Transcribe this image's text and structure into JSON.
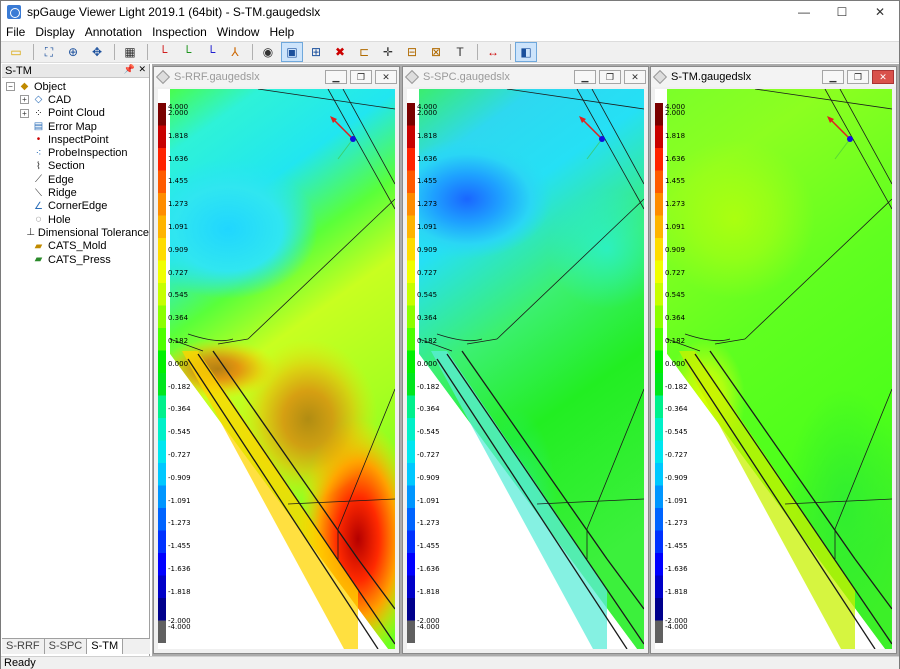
{
  "window": {
    "title": "spGauge Viewer Light 2019.1 (64bit) - S-TM.gaugedslx"
  },
  "menu": [
    "File",
    "Display",
    "Annotation",
    "Inspection",
    "Window",
    "Help"
  ],
  "toolbar_icons": [
    "open-icon",
    "fit-view-icon",
    "zoom-icon",
    "pan-icon",
    "grid-icon",
    "axis-x-icon",
    "axis-y-icon",
    "axis-z-icon",
    "axis-iso-icon",
    "eye-icon",
    "select-icon",
    "add-point-icon",
    "delete-point-icon",
    "label-icon",
    "move-icon",
    "layout-icon",
    "layout-alt-icon",
    "text-icon",
    "measure-icon",
    "compare-icon"
  ],
  "panel": {
    "title": "S-TM"
  },
  "tree": [
    {
      "label": "Object",
      "expand": "−",
      "icon": "object-icon"
    },
    {
      "label": "CAD",
      "expand": "+",
      "icon": "cad-icon"
    },
    {
      "label": "Point Cloud",
      "expand": "+",
      "icon": "point-cloud-icon"
    },
    {
      "label": "Error Map",
      "icon": "error-map-icon"
    },
    {
      "label": "InspectPoint",
      "icon": "inspect-point-icon"
    },
    {
      "label": "ProbeInspection",
      "icon": "probe-inspection-icon"
    },
    {
      "label": "Section",
      "icon": "section-icon"
    },
    {
      "label": "Edge",
      "icon": "edge-icon"
    },
    {
      "label": "Ridge",
      "icon": "ridge-icon"
    },
    {
      "label": "CornerEdge",
      "icon": "corner-edge-icon"
    },
    {
      "label": "Hole",
      "icon": "hole-icon"
    },
    {
      "label": "Dimensional Tolerance",
      "icon": "dimensional-tolerance-icon"
    },
    {
      "label": "CATS_Mold",
      "icon": "cats-mold-icon"
    },
    {
      "label": "CATS_Press",
      "icon": "cats-press-icon"
    }
  ],
  "bottom_tabs": [
    "S-RRF",
    "S-SPC",
    "S-TM"
  ],
  "active_tab": "S-TM",
  "status": "Ready",
  "views": [
    {
      "title": "S-RRF.gaugedslx",
      "active": false,
      "variant": "rrf"
    },
    {
      "title": "S-SPC.gaugedslx",
      "active": false,
      "variant": "spc"
    },
    {
      "title": "S-TM.gaugedslx",
      "active": true,
      "variant": "tm"
    }
  ],
  "legend": {
    "labels": [
      "4.000",
      "2.000",
      "1.818",
      "1.636",
      "1.455",
      "1.273",
      "1.091",
      "0.909",
      "0.727",
      "0.545",
      "0.364",
      "0.182",
      "0.000",
      "-0.182",
      "-0.364",
      "-0.545",
      "-0.727",
      "-0.909",
      "-1.091",
      "-1.273",
      "-1.455",
      "-1.636",
      "-1.818",
      "-2.000",
      "-4.000"
    ],
    "colors": [
      "#7a0000",
      "#c80000",
      "#ff2200",
      "#ff5a00",
      "#ff8c00",
      "#ffb400",
      "#ffdc00",
      "#f0ff00",
      "#c6ff00",
      "#8cff00",
      "#4dff00",
      "#00f000",
      "#00e61e",
      "#00f08c",
      "#00f0c8",
      "#00e6f0",
      "#00c8ff",
      "#0096ff",
      "#0064ff",
      "#0032ff",
      "#0000ff",
      "#0000c8",
      "#00008c",
      "#606060"
    ]
  }
}
